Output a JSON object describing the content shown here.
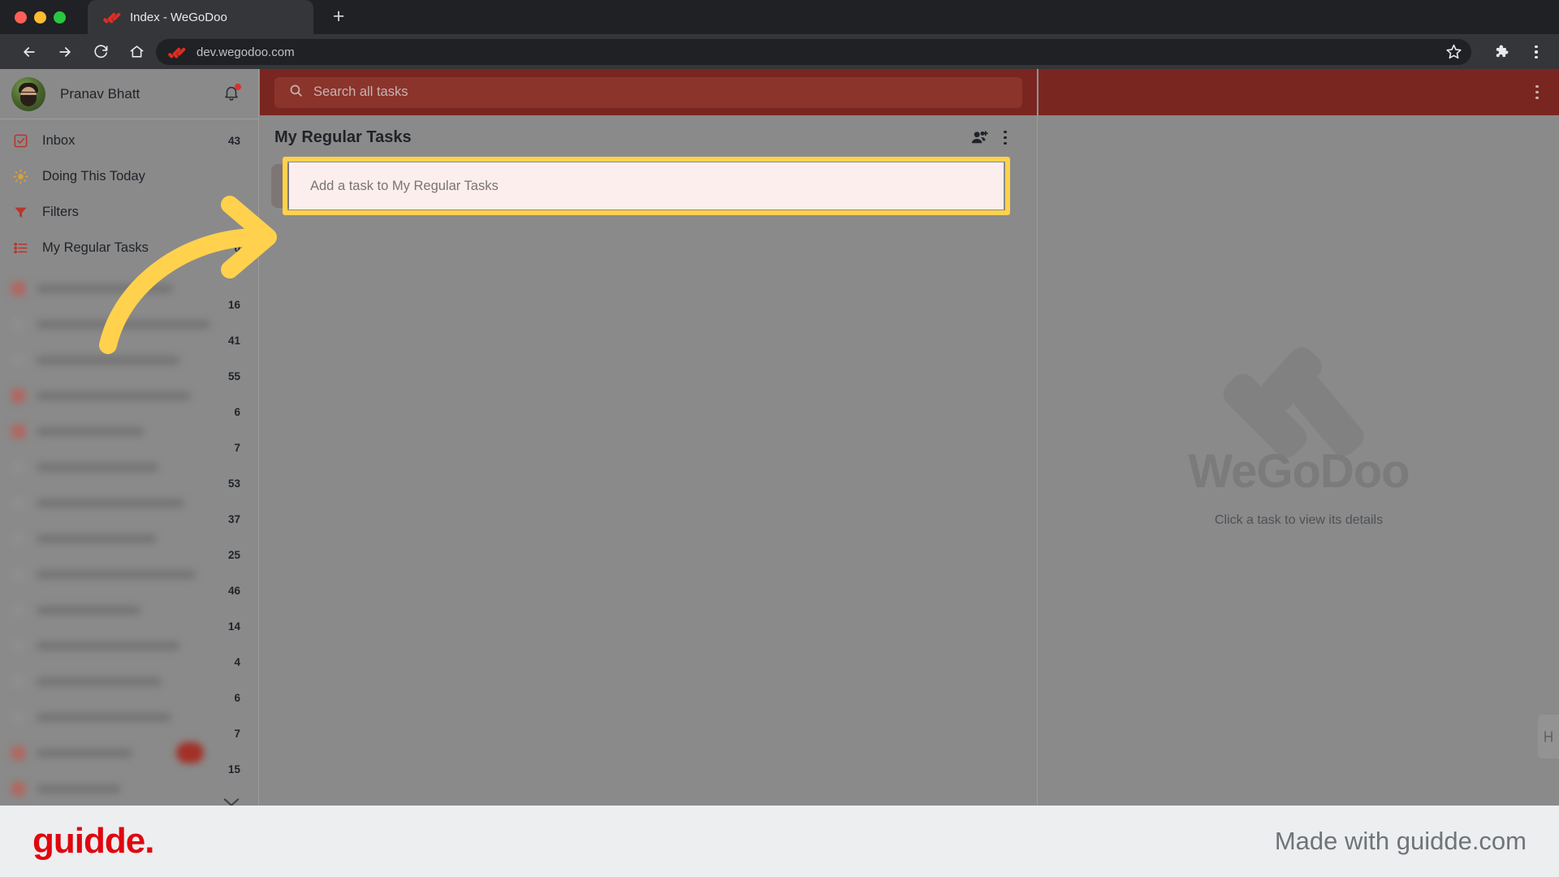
{
  "browser": {
    "tab_title": "Index - WeGoDoo",
    "new_tab_label": "+",
    "url": "dev.wegodoo.com",
    "icons": {
      "back": "back-arrow-icon",
      "forward": "forward-arrow-icon",
      "reload": "reload-icon",
      "home": "home-icon",
      "bookmark": "star-icon",
      "extensions": "puzzle-icon",
      "menu": "three-dot-menu-icon"
    }
  },
  "sidebar": {
    "user": {
      "name": "Pranav Bhatt",
      "has_notification": true
    },
    "nav": [
      {
        "label": "Inbox",
        "count": "43",
        "icon": "inbox-checkbox-icon"
      },
      {
        "label": "Doing This Today",
        "count": "",
        "icon": "sun-icon"
      },
      {
        "label": "Filters",
        "count": "",
        "icon": "funnel-icon"
      },
      {
        "label": "My Regular Tasks",
        "count": "0",
        "icon": "list-icon"
      }
    ],
    "redacted_projects": [
      {
        "count": "16"
      },
      {
        "count": "41"
      },
      {
        "count": "55"
      },
      {
        "count": "6"
      },
      {
        "count": "7"
      },
      {
        "count": "53"
      },
      {
        "count": "37"
      },
      {
        "count": "25"
      },
      {
        "count": "46"
      },
      {
        "count": "14"
      },
      {
        "count": "4"
      },
      {
        "count": "6"
      },
      {
        "count": "7"
      },
      {
        "count": "15"
      }
    ],
    "expand_icon": "chevron-down-icon"
  },
  "topbar": {
    "search_placeholder": "Search all tasks",
    "search_value": "",
    "search_icon": "search-icon",
    "overflow_icon": "three-dot-menu-icon"
  },
  "list": {
    "title": "My Regular Tasks",
    "share_icon": "add-people-icon",
    "more_icon": "three-dot-menu-icon",
    "add_task_placeholder": "Add a task to My Regular Tasks",
    "add_task_value": ""
  },
  "detail_panel": {
    "logo_text": "WeGoDoo",
    "empty_message": "Click a task to view its details",
    "side_tab_icon": "panel-toggle-icon"
  },
  "footer": {
    "logo_text": "guidde.",
    "made_with": "Made with guidde.com"
  },
  "annotation": {
    "type": "curved-arrow",
    "color": "#ffd14d",
    "points_to": "add-task-input"
  },
  "colors": {
    "brand_red": "#7a2620",
    "accent_yellow": "#ffd14d",
    "guidde_red": "#e1060e",
    "app_bg": "#8a8a8a",
    "input_bg": "#fbeeec"
  }
}
